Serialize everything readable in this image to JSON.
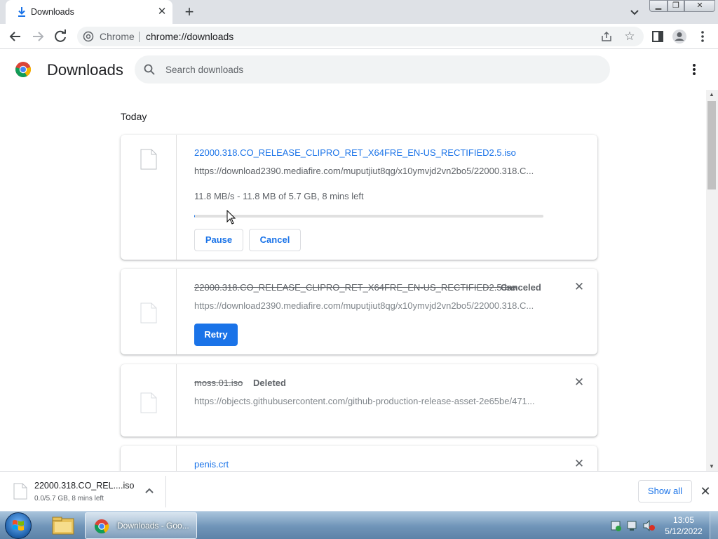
{
  "tab": {
    "title": "Downloads",
    "close": "✕"
  },
  "newtab": "+",
  "window_buttons": {
    "min": "▁",
    "max": "❐",
    "close": "✕"
  },
  "omnibox": {
    "chip": "Chrome",
    "url": "chrome://downloads"
  },
  "page": {
    "title": "Downloads",
    "search_placeholder": "Search downloads"
  },
  "section": {
    "date": "Today"
  },
  "downloads": [
    {
      "name": "22000.318.CO_RELEASE_CLIPRO_RET_X64FRE_EN-US_RECTIFIED2.5.iso",
      "url": "https://download2390.mediafire.com/muputjiut8qg/x10ymvjd2vn2bo5/22000.318.C...",
      "status": "11.8 MB/s - 11.8 MB of 5.7 GB, 8 mins left",
      "progress": 0.002,
      "buttons": {
        "pause": "Pause",
        "cancel": "Cancel"
      }
    },
    {
      "name": "22000.318.CO_RELEASE_CLIPRO_RET_X64FRE_EN-US_RECTIFIED2.5.iso",
      "state": "Canceled",
      "url": "https://download2390.mediafire.com/muputjiut8qg/x10ymvjd2vn2bo5/22000.318.C...",
      "buttons": {
        "retry": "Retry"
      }
    },
    {
      "name": "moss.01.iso",
      "state": "Deleted",
      "url": "https://objects.githubusercontent.com/github-production-release-asset-2e65be/471..."
    },
    {
      "name": "penis.crt"
    }
  ],
  "shelf": {
    "name": "22000.318.CO_REL....iso",
    "status": "0.0/5.7 GB, 8 mins left",
    "show_all": "Show all",
    "close": "✕"
  },
  "taskbar": {
    "chrome_label": "Downloads - Goo...",
    "time": "13:05",
    "date": "5/12/2022"
  },
  "colors": {
    "accent": "#1a73e8",
    "tabstrip": "#dee1e6",
    "omnibox": "#f1f3f4"
  }
}
